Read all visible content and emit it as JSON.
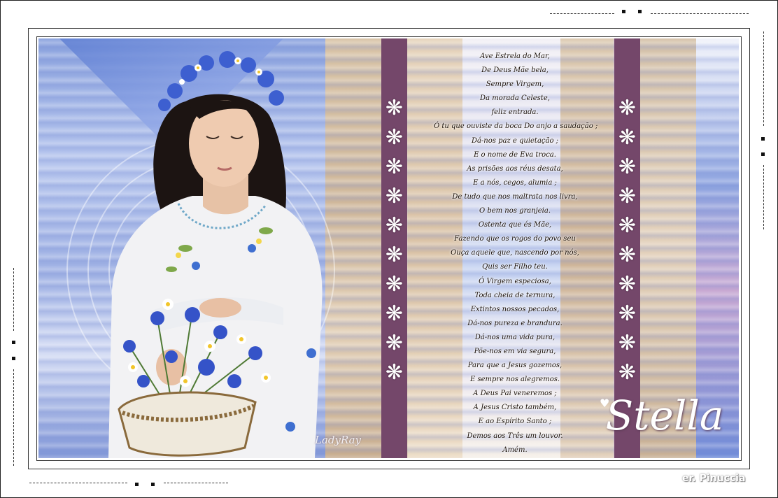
{
  "poem": {
    "lines": [
      "Ave Estrela do Mar,",
      "De Deus Mãe bela,",
      "Sempre Virgem,",
      "Da morada Celeste,",
      "feliz entrada.",
      "Ó tu que ouviste da boca Do anjo a saudação ;",
      "Dá-nos paz e quietação ;",
      "E o nome de Eva troca.",
      "As prisões aos réus desata,",
      "E a nós, cegos, alumia ;",
      "De tudo que nos maltrata nos livra,",
      "O bem nos granjeia.",
      "Ostenta que és Mãe,",
      "Fazendo que os rogos do povo seu",
      "Ouça aquele que, nascendo por nós,",
      "Quis ser Filho teu.",
      "Ó Virgem especiosa,",
      "Toda cheia de ternura,",
      "Extintos nossos pecados,",
      "Dá-nos pureza e brandura.",
      "Dá-nos uma vida pura,",
      "Põe-nos em via segura,",
      "Para que a Jesus gozemos,",
      "E sempre nos alegremos.",
      "A Deus Pai veneremos ;",
      "A Jesus Cristo também,",
      "E ao Espírito Santo ;",
      "Demos aos Três um louvor.",
      "Amém."
    ]
  },
  "title": "Stella",
  "watermark": "LadyRay",
  "credit": "er. Pinuccia",
  "decorations": {
    "flower_glyph": "❋",
    "heart_glyph": "♥",
    "flower_icon": "white-flower-icon"
  },
  "colors": {
    "stripe_purple": "#74476a",
    "frame": "#333333",
    "background": "#ffffff"
  }
}
